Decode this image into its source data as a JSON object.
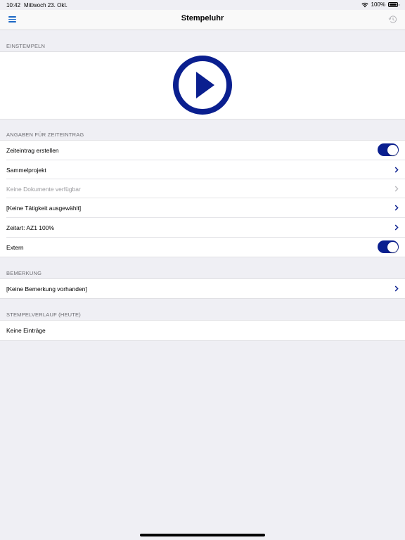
{
  "status_bar": {
    "time": "10:42",
    "date": "Mittwoch 23. Okt.",
    "battery": "100%"
  },
  "nav": {
    "title": "Stempeluhr",
    "menu_icon": "hamburger-menu-icon",
    "history_icon": "history-icon"
  },
  "colors": {
    "accent": "#0a1f8f",
    "nav_icon": "#1a66c4",
    "background": "#efeff4"
  },
  "sections": {
    "einstempeln": {
      "header": "EINSTEMPELN",
      "play_icon": "play-icon"
    },
    "angaben": {
      "header": "ANGABEN FÜR ZEITEINTRAG",
      "rows": [
        {
          "label": "Zeiteintrag erstellen",
          "control": "toggle",
          "on": true
        },
        {
          "label": "Sammelprojekt",
          "control": "chevron"
        },
        {
          "label": "Keine Dokumente verfügbar",
          "control": "chevron",
          "disabled": true
        },
        {
          "label": "[Keine Tätigkeit ausgewählt]",
          "control": "chevron"
        },
        {
          "label": "Zeitart: AZ1 100%",
          "control": "chevron"
        },
        {
          "label": "Extern",
          "control": "toggle",
          "on": true
        }
      ]
    },
    "bemerkung": {
      "header": "BEMERKUNG",
      "value": "[Keine Bemerkung vorhanden]"
    },
    "stempelverlauf": {
      "header": "STEMPELVERLAUF (HEUTE)",
      "value": "Keine Einträge"
    }
  }
}
